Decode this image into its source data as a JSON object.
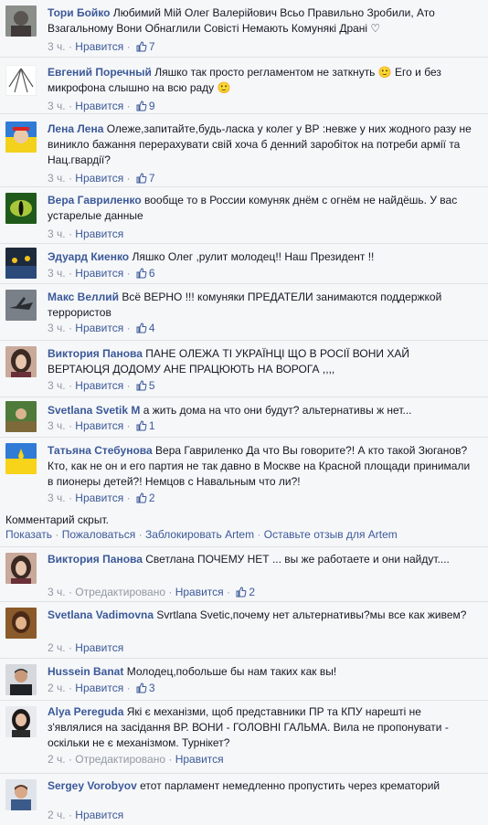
{
  "comments": [
    {
      "author": "Тори Бойко",
      "text": "Любимий Мій Олег Валерійович Всьо Правильно Зробили, Ато Взагальному Вони Обнаглили Совісті Немають Комунякі Драні ♡",
      "time": "3 ч.",
      "like": "Нравится",
      "likes": "7",
      "edited": ""
    },
    {
      "author": "Евгений Поречный",
      "text": "Ляшко так просто регламентом не заткнуть 🙂 Его и без микрофона слышно на всю раду 🙂",
      "time": "3 ч.",
      "like": "Нравится",
      "likes": "9",
      "edited": ""
    },
    {
      "author": "Лена Лена",
      "text": "Олеже,запитайте,будь-ласка у колег у ВР :невже у них жодного разу не виникло бажання перерахувати свій хоча б денний заробіток на потреби армії та Нац.гвардії?",
      "time": "3 ч.",
      "like": "Нравится",
      "likes": "7",
      "edited": ""
    },
    {
      "author": "Вера Гавриленко",
      "text": "вообще то в России комуняк днём с огнём не найдёшь. У вас устарелые данные",
      "time": "3 ч.",
      "like": "Нравится",
      "likes": "",
      "edited": ""
    },
    {
      "author": "Эдуард Киенко",
      "text": "Ляшко Олег ,рулит молодец!! Наш Президент !!",
      "time": "3 ч.",
      "like": "Нравится",
      "likes": "6",
      "edited": ""
    },
    {
      "author": "Макс Веллий",
      "text": "Всё ВЕРНО !!! комуняки ПРЕДАТЕЛИ занимаются поддержкой террористов",
      "time": "3 ч.",
      "like": "Нравится",
      "likes": "4",
      "edited": ""
    },
    {
      "author": "Виктория Панова",
      "text": "ПАНЕ ОЛЕЖА ТІ УКРАЇНЦІ ЩО В РОСІЇ ВОНИ ХАЙ ВЕРТАЮЦЯ ДОДОМУ АНЕ ПРАЦЮЮТЬ НА ВОРОГА ,,,,",
      "time": "3 ч.",
      "like": "Нравится",
      "likes": "5",
      "edited": ""
    },
    {
      "author": "Svetlana Svetik M",
      "text": "а жить дома на что они будут? альтернативы ж нет...",
      "time": "3 ч.",
      "like": "Нравится",
      "likes": "1",
      "edited": ""
    },
    {
      "author": "Татьяна Стебунова",
      "text": "Вера Гавриленко Да что Вы говорите?! А кто такой Зюганов? Кто, как не он и его партия не так давно в Москве на Красной площади принимали в пионеры детей?! Немцов с Навальным что ли?!",
      "time": "3 ч.",
      "like": "Нравится",
      "likes": "2",
      "edited": ""
    },
    {
      "author": "Виктория Панова",
      "text": "Светлана ПОЧЕМУ НЕТ ... вы же работаете и они найдут....",
      "time": "3 ч.",
      "like": "Нравится",
      "likes": "2",
      "edited": "Отредактировано"
    },
    {
      "author": "Svetlana Vadimovna",
      "text": "Svrtlana Svetic,почему нет альтернативы?мы все как живем?",
      "time": "2 ч.",
      "like": "Нравится",
      "likes": "",
      "edited": ""
    },
    {
      "author": "Hussein Banat",
      "text": "Молодец,побольше бы нам таких как вы!",
      "time": "2 ч.",
      "like": "Нравится",
      "likes": "3",
      "edited": ""
    },
    {
      "author": "Alya Pereguda",
      "text": "Які є механізми, щоб представники ПР та КПУ нарешті не з'являлися на засідання ВР. ВОНИ - ГОЛОВНІ ГАЛЬМА. Вила не пропонувати - оскільки не є механізмом. Турнікет?",
      "time": "2 ч.",
      "like": "Нравится",
      "likes": "",
      "edited": "Отредактировано"
    },
    {
      "author": "Sergey Vorobyov",
      "text": "етот парламент немедленно пропустить через крематорий",
      "time": "2 ч.",
      "like": "Нравится",
      "likes": "",
      "edited": ""
    }
  ],
  "hidden": {
    "note": "Комментарий скрыт.",
    "show": "Показать",
    "complain": "Пожаловаться",
    "block": "Заблокировать Artem",
    "feedback": "Оставьте отзыв для Artem"
  },
  "colors": {
    "link": "#3b5998",
    "muted": "#9197a3",
    "text": "#141823",
    "bg": "#f6f7f9"
  }
}
